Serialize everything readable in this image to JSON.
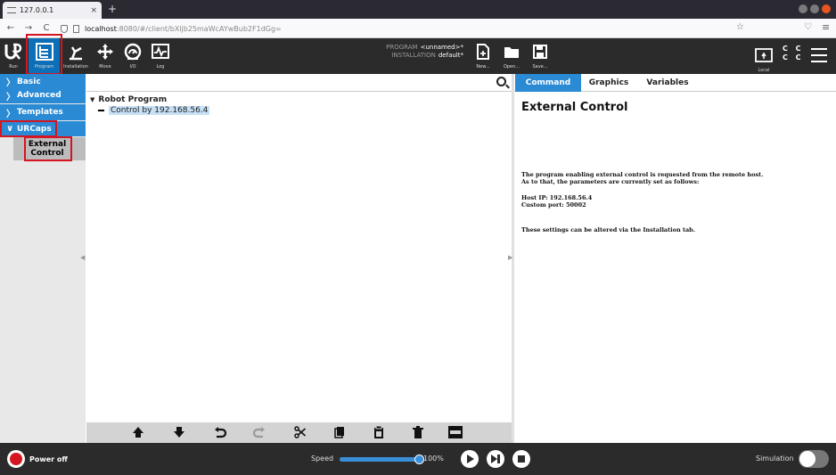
{
  "browser": {
    "tab_title": "127.0.0.1",
    "tab_close": "×",
    "new_tab": "+",
    "url_host": "localhost",
    "url_path": ":8080/#/client/bXljb25maWcAYwBub2F1dGg=",
    "back": "←",
    "forward": "→",
    "reload": "C"
  },
  "header": {
    "nav": [
      {
        "label": "Run"
      },
      {
        "label": "Program"
      },
      {
        "label": "Installation"
      },
      {
        "label": "Move"
      },
      {
        "label": "I/O"
      },
      {
        "label": "Log"
      }
    ],
    "program_key": "PROGRAM",
    "program_value": "<unnamed>*",
    "installation_key": "INSTALLATION",
    "installation_value": "default*",
    "file_buttons": [
      {
        "label": "New..."
      },
      {
        "label": "Open..."
      },
      {
        "label": "Save..."
      }
    ],
    "local_label": "Local",
    "cc_label_1": "C C",
    "cc_label_2": "C C",
    "accent": "#2a8ad4",
    "highlight": "#d51521"
  },
  "sidebar": {
    "categories": [
      {
        "label": "Basic",
        "chevron": "〉"
      },
      {
        "label": "Advanced",
        "chevron": "〉"
      },
      {
        "label": "Templates",
        "chevron": "〉"
      },
      {
        "label": "URCaps",
        "chevron": "∨"
      }
    ],
    "urcaps_sub": {
      "line1": "External",
      "line2": "Control"
    }
  },
  "tree": {
    "root": "Robot Program",
    "node": "Control by 192.168.56.4"
  },
  "right_panel": {
    "tabs": [
      "Command",
      "Graphics",
      "Variables"
    ],
    "title": "External Control",
    "lines": [
      "The program enabling external control is requested from the remote host.",
      "As to that, the parameters are currently set as follows:",
      "Host IP: 192.168.56.4",
      "Custom port: 50002",
      "These settings can be altered via the Installation tab."
    ]
  },
  "footer": {
    "power_label": "Power off",
    "speed_label": "Speed",
    "speed_percent": 100,
    "speed_text": "100%",
    "simulation_label": "Simulation"
  }
}
